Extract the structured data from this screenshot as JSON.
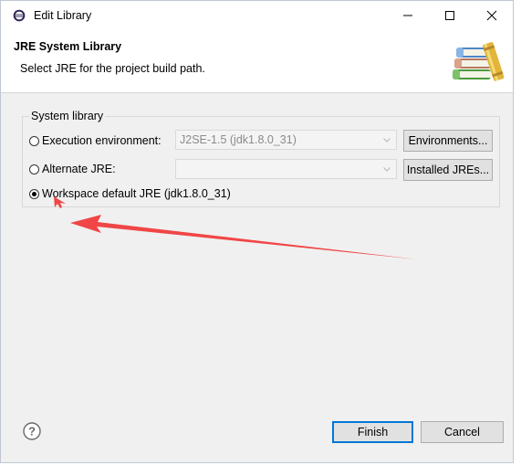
{
  "window": {
    "title": "Edit Library"
  },
  "header": {
    "title": "JRE System Library",
    "message": "Select JRE for the project build path."
  },
  "group": {
    "label": "System library",
    "options": [
      {
        "label": "Execution environment:",
        "selected": false,
        "combo_value": "J2SE-1.5 (jdk1.8.0_31)",
        "button_label": "Environments..."
      },
      {
        "label": "Alternate JRE:",
        "selected": false,
        "combo_value": "",
        "button_label": "Installed JREs..."
      },
      {
        "label": "Workspace default JRE (jdk1.8.0_31)",
        "selected": true
      }
    ]
  },
  "footer": {
    "finish_label": "Finish",
    "cancel_label": "Cancel"
  },
  "colors": {
    "annotation_arrow": "#f04646",
    "default_button_border": "#0078d7"
  },
  "icons": {
    "app": "eclipse-icon",
    "help": "help-icon",
    "banner": "library-books-icon"
  }
}
